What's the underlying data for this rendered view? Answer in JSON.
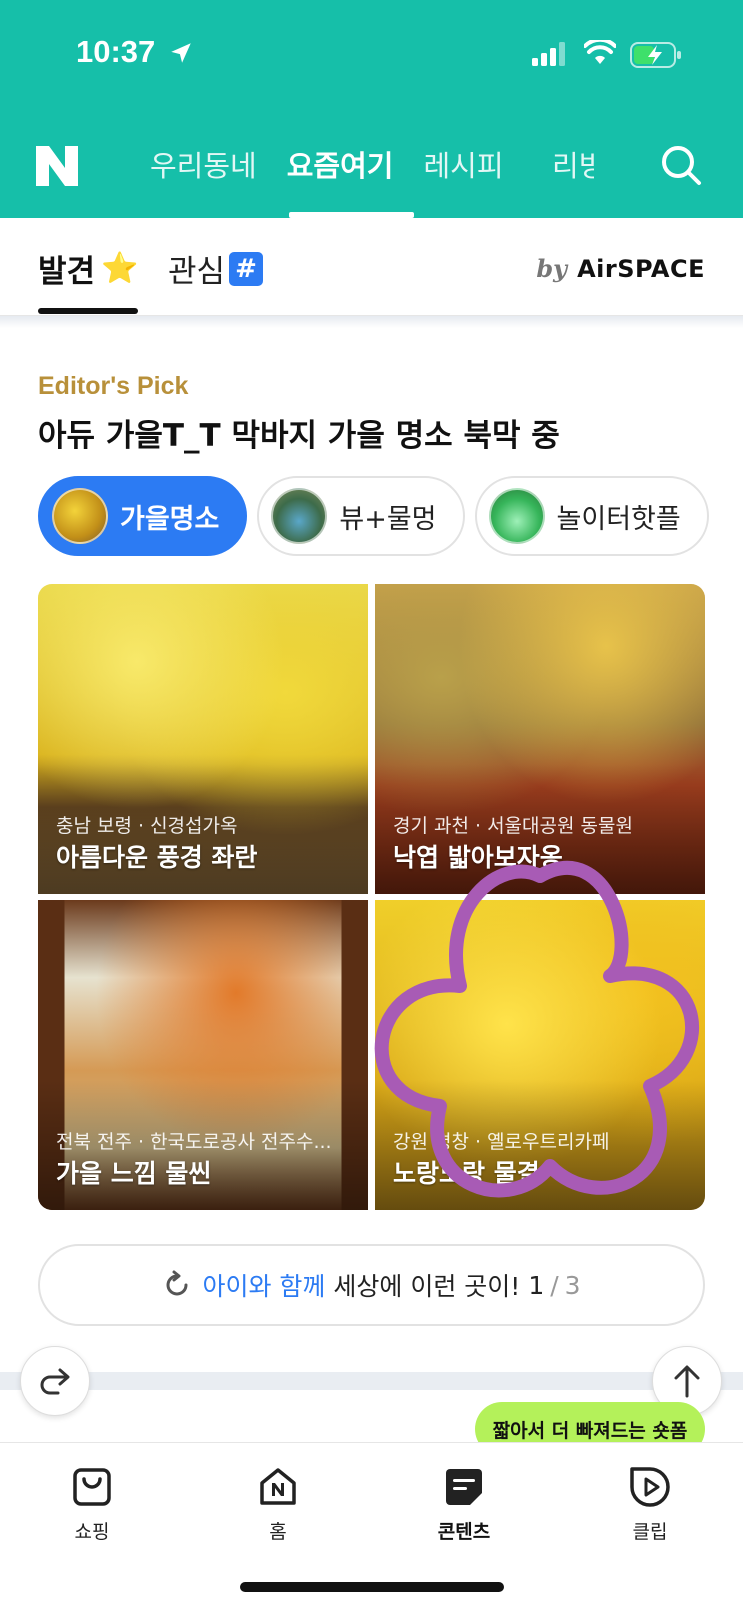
{
  "status_bar": {
    "time": "10:37"
  },
  "header": {
    "logo_letter": "N",
    "tabs": [
      {
        "label": "우리동네"
      },
      {
        "label": "요즘여기"
      },
      {
        "label": "레시피"
      },
      {
        "label": "리빙"
      }
    ],
    "active_tab": "요즘여기"
  },
  "subtabs": {
    "discover": {
      "label": "발견",
      "emoji": "⭐"
    },
    "interest": {
      "label": "관심",
      "badge": "#"
    },
    "byline": {
      "by": "by",
      "brand": "AirSPACE"
    }
  },
  "pick": {
    "label": "Editor's Pick",
    "title": "아듀 가을T_T 막바지 가을 명소 북막 중"
  },
  "chips": [
    {
      "label": "가을명소",
      "active": true
    },
    {
      "label": "뷰+물멍",
      "active": false
    },
    {
      "label": "놀이터핫플",
      "active": false
    }
  ],
  "cards": [
    {
      "location": "충남 보령 · 신경섭가옥",
      "title": "아름다운 풍경 좌란"
    },
    {
      "location": "경기 과천 · 서울대공원 동물원",
      "title": "낙엽 밟아보자옹"
    },
    {
      "location": "전북 전주 · 한국도로공사 전주수...",
      "title": "가을 느낌 물씬"
    },
    {
      "location": "강원 평창 · 옐로우트리카페",
      "title": "노랑노랑 물결"
    }
  ],
  "next": {
    "highlight": "아이와 함께",
    "text": "세상에 이런 곳이!",
    "current": "1",
    "separator": "/",
    "total": "3"
  },
  "tooltip": "짧아서 더 빠져드는 숏폼",
  "bottom_nav": [
    {
      "label": "쇼핑",
      "icon": "shopping-bag-icon"
    },
    {
      "label": "홈",
      "icon": "home-icon"
    },
    {
      "label": "콘텐츠",
      "icon": "content-icon",
      "active": true
    },
    {
      "label": "클립",
      "icon": "clip-play-icon"
    }
  ],
  "colors": {
    "header": "#16bfa9",
    "accent": "#2c7bf3",
    "pick_label": "#b8903a",
    "tooltip": "#b4f15a",
    "annotation": "#a85bb5"
  }
}
